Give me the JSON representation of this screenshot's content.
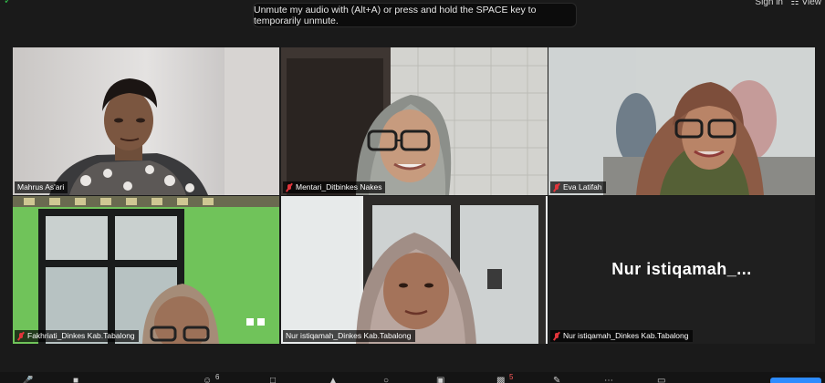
{
  "topbar": {
    "sign_in": "Sign in",
    "view": "View"
  },
  "notification": "Unmute my audio with (Alt+A) or press and hold the SPACE key to temporarily unmute.",
  "participants": [
    {
      "name": "Mahrus As'ari"
    },
    {
      "name": "Mentari_Ditbinkes Nakes"
    },
    {
      "name": "Eva Latifah"
    },
    {
      "name": "Fakhriati_Dinkes Kab.Tabalong"
    },
    {
      "name": "Nur istiqamah_Dinkes Kab.Tabalong"
    },
    {
      "name": "Nur istiqamah_Dinkes Kab.Tabalong",
      "display_name": "Nur  istiqamah_..."
    }
  ],
  "toolbar": {
    "participants_count": "6",
    "chat_badge": "5"
  },
  "colors": {
    "active_speaker": "#c9e265",
    "muted": "#e0353b",
    "accent": "#2d8cff"
  }
}
